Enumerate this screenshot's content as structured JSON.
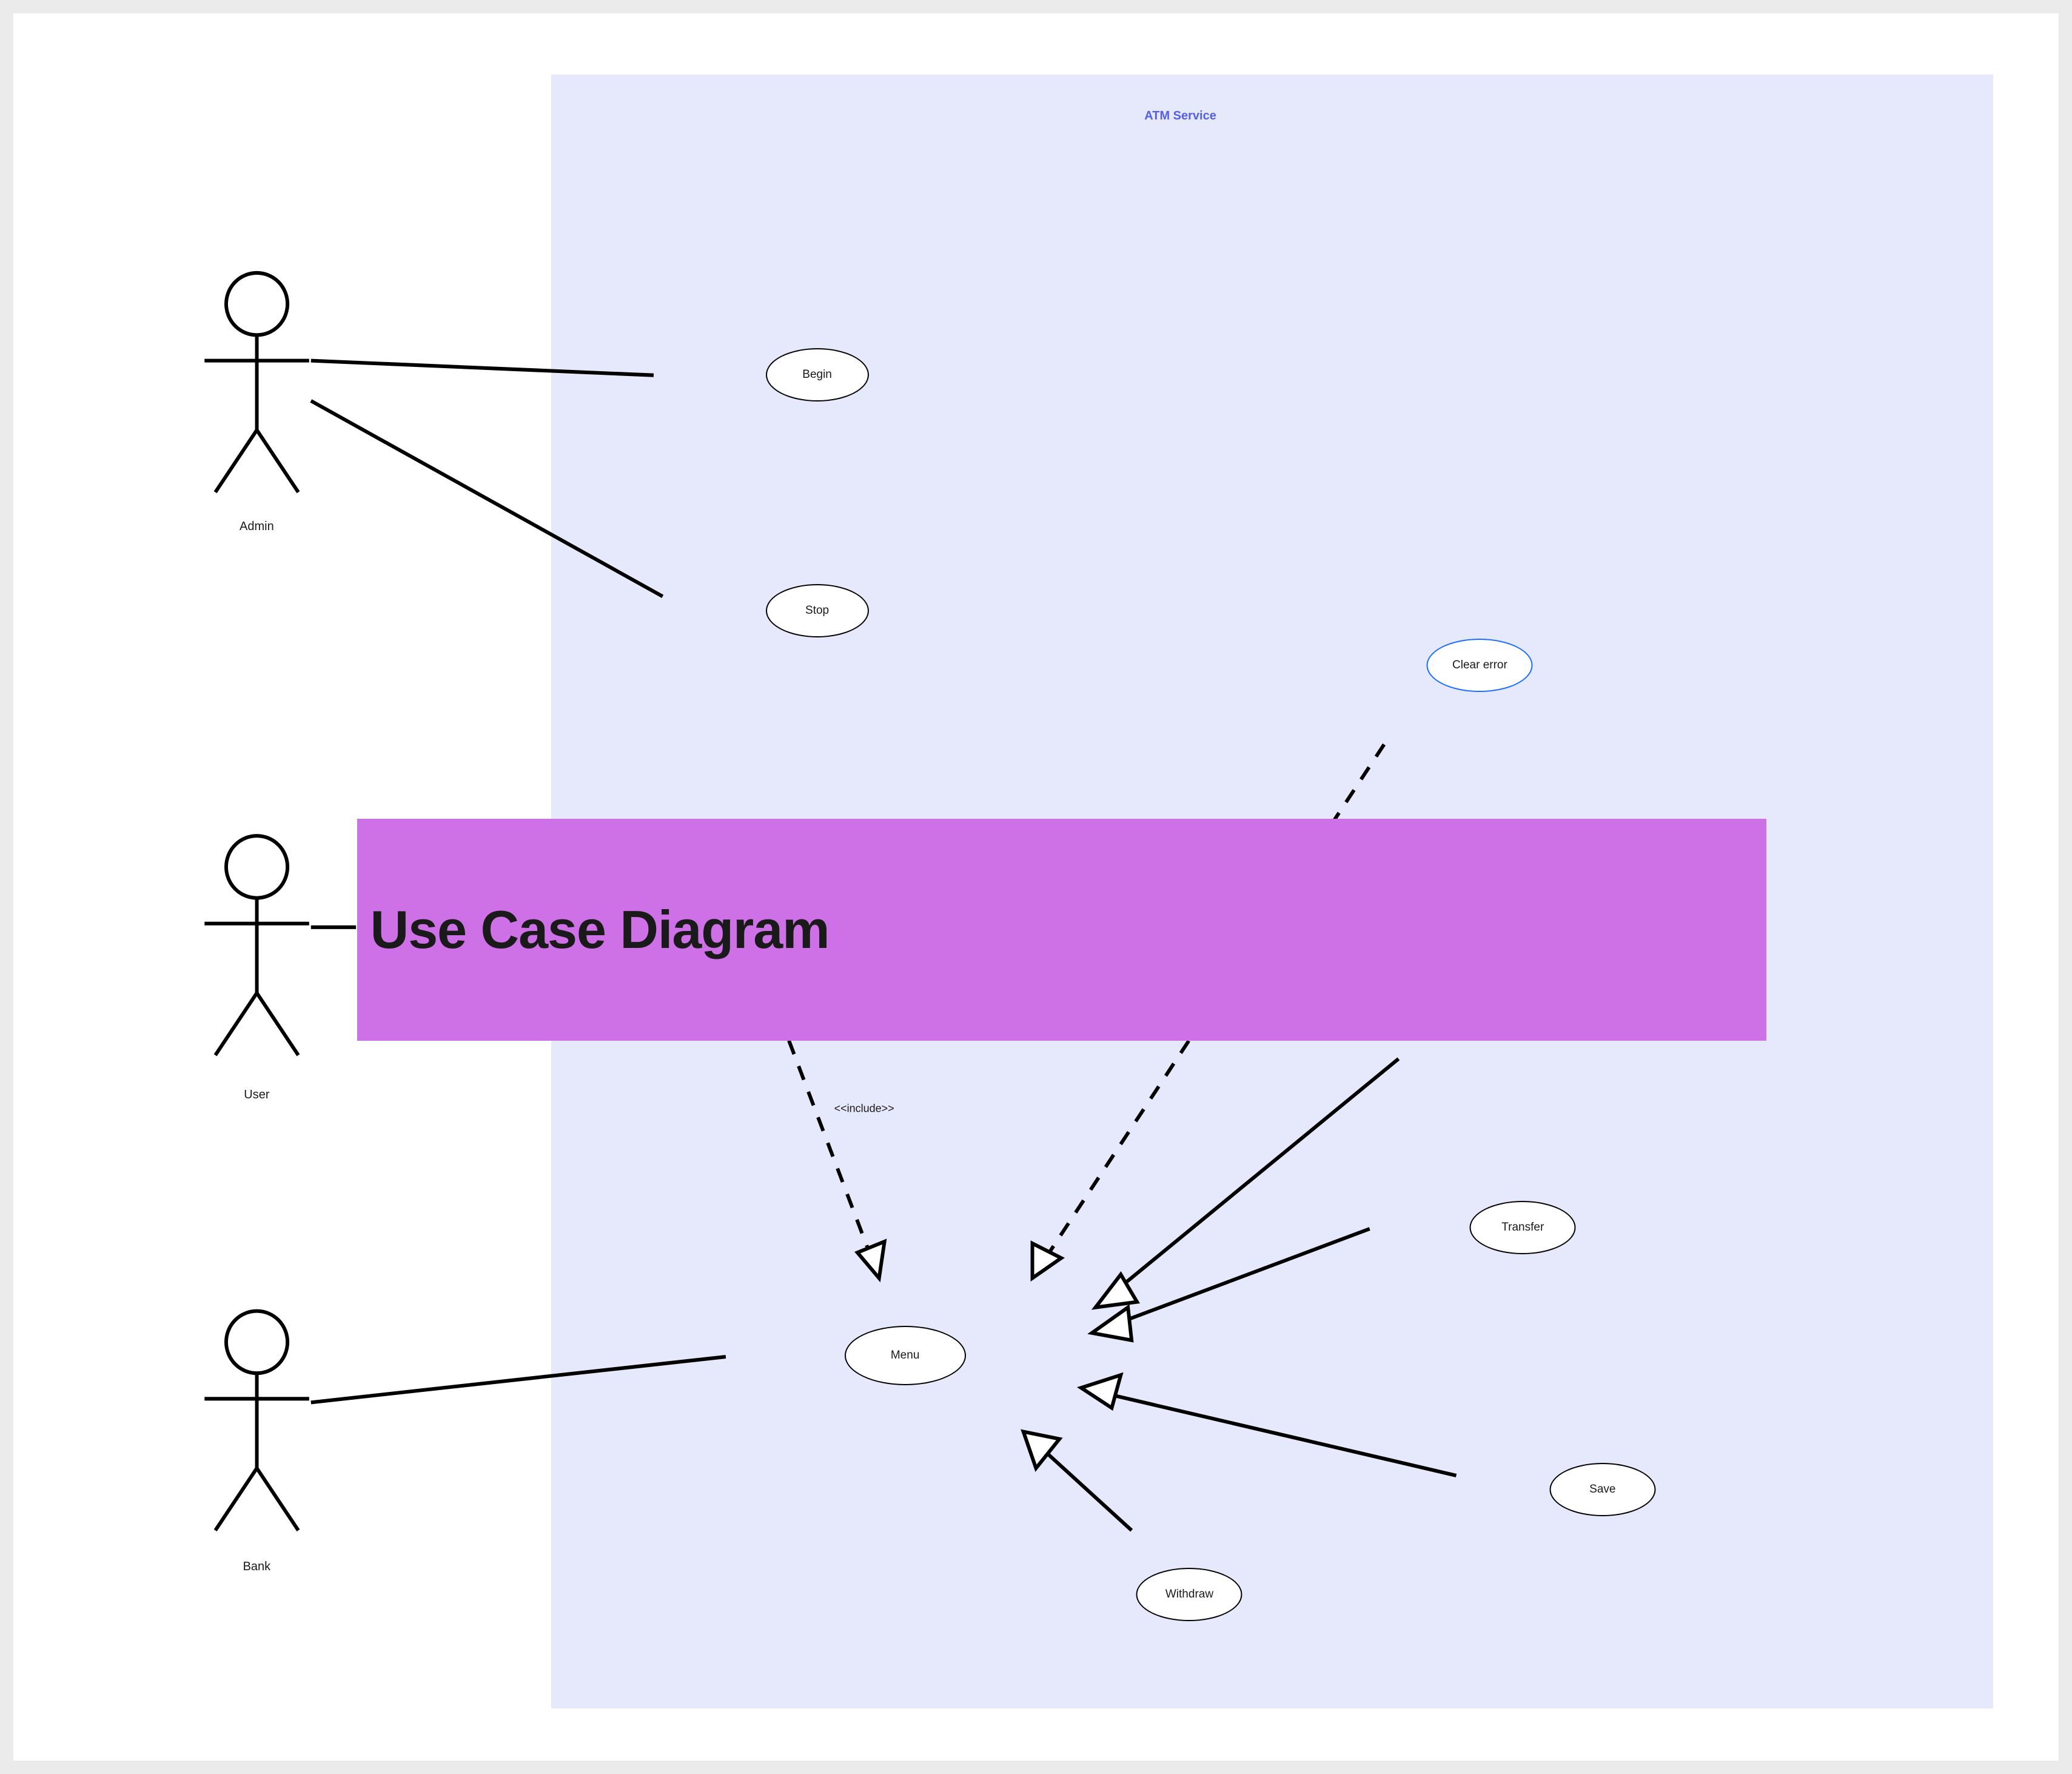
{
  "system": {
    "title": "ATM Service"
  },
  "actors": {
    "admin": "Admin",
    "user": "User",
    "bank": "Bank"
  },
  "usecases": {
    "begin": "Begin",
    "stop": "Stop",
    "clear_error": "Clear error",
    "menu": "Menu",
    "transfer": "Transfer",
    "save": "Save",
    "withdraw": "Withdraw"
  },
  "relationships": {
    "include_label": "<<include>>"
  },
  "banner": {
    "title": "Use Case Diagram"
  },
  "colors": {
    "page_bg": "#ebebeb",
    "card_bg": "#ffffff",
    "system_bg": "#e6e8fb",
    "system_title": "#5560e8",
    "banner_bg": "#cf71e6",
    "selected_stroke": "#1a6dff"
  }
}
